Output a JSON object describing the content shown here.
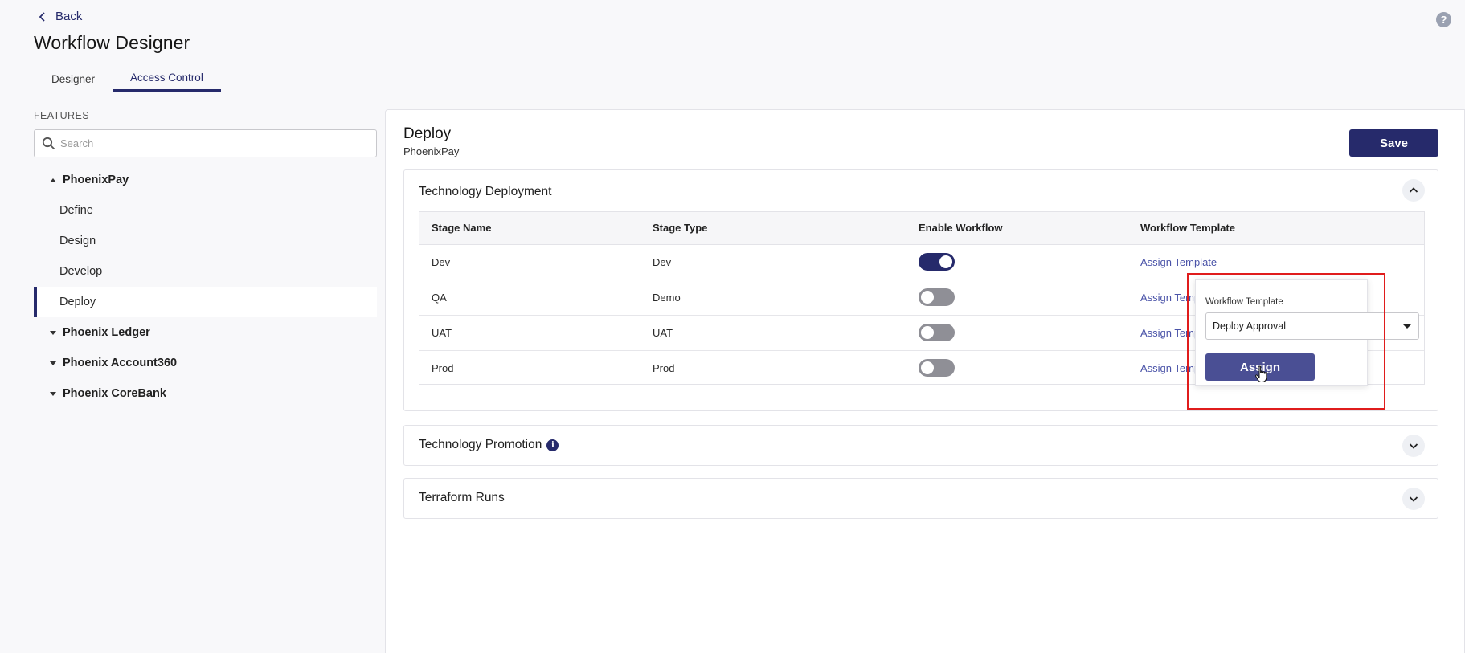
{
  "header": {
    "back_label": "Back",
    "title": "Workflow Designer",
    "tabs": [
      {
        "label": "Designer",
        "active": false
      },
      {
        "label": "Access Control",
        "active": true
      }
    ],
    "help_icon": "?"
  },
  "sidebar": {
    "section_label": "FEATURES",
    "search_placeholder": "Search",
    "tree": [
      {
        "label": "PhoenixPay",
        "expanded": true,
        "children": [
          "Define",
          "Design",
          "Develop",
          "Deploy"
        ],
        "selected_child": "Deploy"
      },
      {
        "label": "Phoenix Ledger",
        "expanded": false
      },
      {
        "label": "Phoenix Account360",
        "expanded": false
      },
      {
        "label": "Phoenix CoreBank",
        "expanded": false
      }
    ]
  },
  "main": {
    "title": "Deploy",
    "subtitle": "PhoenixPay",
    "save_label": "Save",
    "sections": [
      {
        "title": "Technology Deployment",
        "expanded": true,
        "columns": [
          "Stage Name",
          "Stage Type",
          "Enable Workflow",
          "Workflow Template"
        ],
        "rows": [
          {
            "stage_name": "Dev",
            "stage_type": "Dev",
            "enabled": true,
            "template_link": "Assign Template"
          },
          {
            "stage_name": "QA",
            "stage_type": "Demo",
            "enabled": false,
            "template_link": "Assign Template"
          },
          {
            "stage_name": "UAT",
            "stage_type": "UAT",
            "enabled": false,
            "template_link": "Assign Template"
          },
          {
            "stage_name": "Prod",
            "stage_type": "Prod",
            "enabled": false,
            "template_link": "Assign Template"
          }
        ]
      },
      {
        "title": "Technology Promotion",
        "expanded": false,
        "has_info_icon": true
      },
      {
        "title": "Terraform Runs",
        "expanded": false
      }
    ]
  },
  "popover": {
    "label": "Workflow Template",
    "selected_value": "Deploy Approval",
    "assign_label": "Assign"
  },
  "colors": {
    "accent": "#262a6b",
    "link": "#4a53a8",
    "highlight": "#e01c1c"
  }
}
